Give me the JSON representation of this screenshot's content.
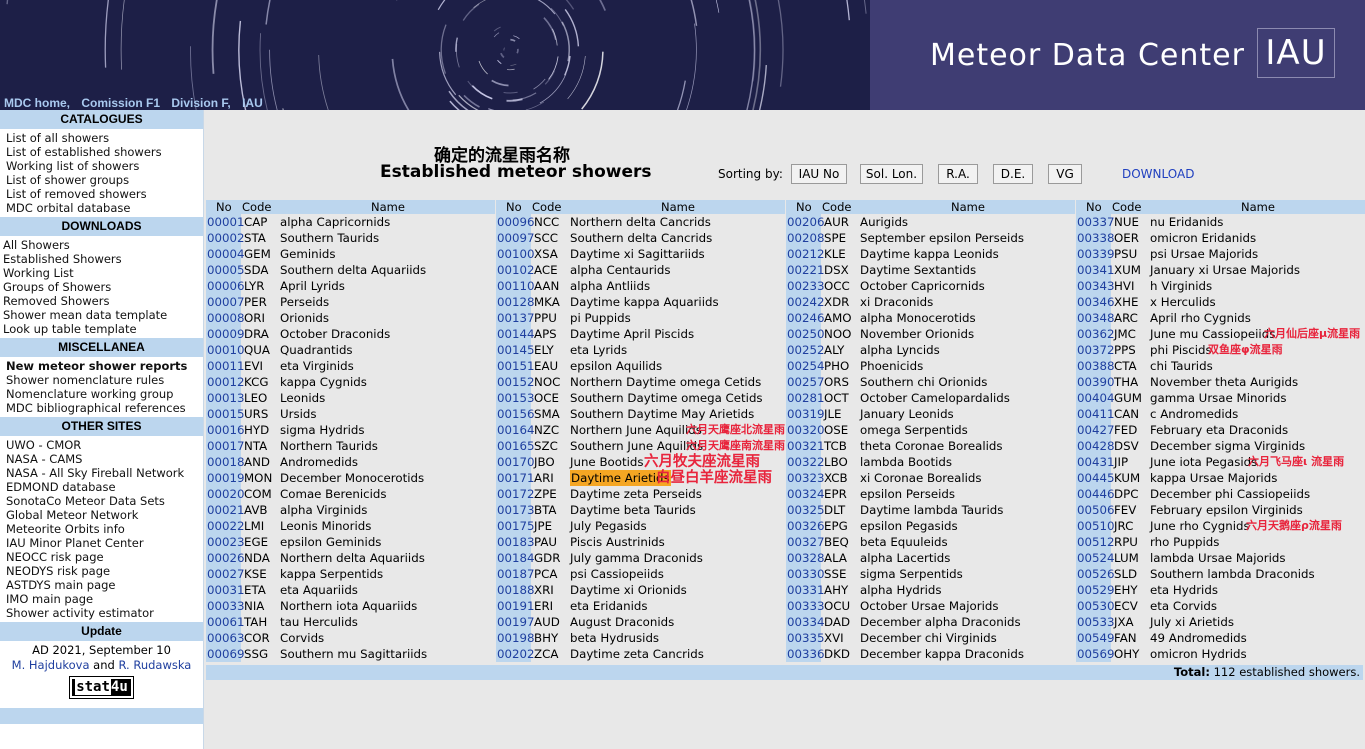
{
  "header": {
    "site_title": "Meteor Data Center",
    "logo_text": "IAU",
    "nav": [
      "MDC home,",
      "Comission F1",
      "Division F,",
      "IAU"
    ]
  },
  "sidebar": {
    "catalogues": {
      "title": "CATALOGUES",
      "items": [
        "List of all showers",
        "List of established showers",
        "Working list of showers",
        "List of shower groups",
        "List of removed showers",
        "MDC orbital database"
      ]
    },
    "downloads": {
      "title": "DOWNLOADS",
      "items": [
        "All Showers",
        "Established Showers",
        "Working List",
        "Groups of Showers",
        "Removed Showers",
        "Shower mean data template",
        "Look up table template"
      ]
    },
    "misc": {
      "title": "MISCELLANEA",
      "items": [
        "New meteor shower reports",
        "Shower nomenclature rules",
        "Nomenclature working group",
        "MDC bibliographical references"
      ]
    },
    "other": {
      "title": "OTHER SITES",
      "items": [
        "UWO - CMOR",
        "NASA - CAMS",
        "NASA - All Sky Fireball Network",
        "EDMOND database",
        "SonotaCo Meteor Data Sets",
        "Global Meteor Network",
        "Meteorite Orbits info",
        "IAU Minor Planet Center",
        "NEOCC risk page",
        "NEODYS risk page",
        "ASTDYS main page",
        "IMO main page",
        "Shower activity estimator"
      ]
    },
    "update": {
      "title": "Update",
      "date": "AD 2021, September 10",
      "author1": "M. Hajdukova",
      "and": "and",
      "author2": "R. Rudawska",
      "counter_a": "stat",
      "counter_b": "4u"
    }
  },
  "main": {
    "title_zh": "确定的流星雨名称",
    "title_en": "Established meteor showers",
    "sort_label": "Sorting by:",
    "sort_buttons": [
      "IAU No",
      "Sol. Lon.",
      "R.A.",
      "D.E.",
      "VG"
    ],
    "download": "DOWNLOAD",
    "col_headers": {
      "no": "No",
      "code": "Code",
      "name": "Name"
    },
    "total_label": "Total:",
    "total_value": "112 established showers."
  },
  "columns": [
    [
      [
        "00001",
        "CAP",
        "alpha Capricornids"
      ],
      [
        "00002",
        "STA",
        "Southern Taurids"
      ],
      [
        "00004",
        "GEM",
        "Geminids"
      ],
      [
        "00005",
        "SDA",
        "Southern delta Aquariids"
      ],
      [
        "00006",
        "LYR",
        "April Lyrids"
      ],
      [
        "00007",
        "PER",
        "Perseids"
      ],
      [
        "00008",
        "ORI",
        "Orionids"
      ],
      [
        "00009",
        "DRA",
        "October Draconids"
      ],
      [
        "00010",
        "QUA",
        "Quadrantids"
      ],
      [
        "00011",
        "EVI",
        "eta Virginids"
      ],
      [
        "00012",
        "KCG",
        "kappa Cygnids"
      ],
      [
        "00013",
        "LEO",
        "Leonids"
      ],
      [
        "00015",
        "URS",
        "Ursids"
      ],
      [
        "00016",
        "HYD",
        "sigma Hydrids"
      ],
      [
        "00017",
        "NTA",
        "Northern Taurids"
      ],
      [
        "00018",
        "AND",
        "Andromedids"
      ],
      [
        "00019",
        "MON",
        "December Monocerotids"
      ],
      [
        "00020",
        "COM",
        "Comae Berenicids"
      ],
      [
        "00021",
        "AVB",
        "alpha Virginids"
      ],
      [
        "00022",
        "LMI",
        "Leonis Minorids"
      ],
      [
        "00023",
        "EGE",
        "epsilon Geminids"
      ],
      [
        "00026",
        "NDA",
        "Northern delta Aquariids"
      ],
      [
        "00027",
        "KSE",
        "kappa Serpentids"
      ],
      [
        "00031",
        "ETA",
        "eta Aquariids"
      ],
      [
        "00033",
        "NIA",
        "Northern iota Aquariids"
      ],
      [
        "00061",
        "TAH",
        "tau Herculids"
      ],
      [
        "00063",
        "COR",
        "Corvids"
      ],
      [
        "00069",
        "SSG",
        "Southern mu Sagittariids"
      ]
    ],
    [
      [
        "00096",
        "NCC",
        "Northern delta Cancrids"
      ],
      [
        "00097",
        "SCC",
        "Southern delta Cancrids"
      ],
      [
        "00100",
        "XSA",
        "Daytime xi Sagittariids"
      ],
      [
        "00102",
        "ACE",
        "alpha Centaurids"
      ],
      [
        "00110",
        "AAN",
        "alpha Antliids"
      ],
      [
        "00128",
        "MKA",
        "Daytime kappa Aquariids"
      ],
      [
        "00137",
        "PPU",
        "pi Puppids"
      ],
      [
        "00144",
        "APS",
        "Daytime April Piscids"
      ],
      [
        "00145",
        "ELY",
        "eta Lyrids"
      ],
      [
        "00151",
        "EAU",
        "epsilon Aquilids"
      ],
      [
        "00152",
        "NOC",
        "Northern Daytime omega Cetids"
      ],
      [
        "00153",
        "OCE",
        "Southern Daytime omega Cetids"
      ],
      [
        "00156",
        "SMA",
        "Southern Daytime May Arietids"
      ],
      [
        "00164",
        "NZC",
        "Northern June Aquilids"
      ],
      [
        "00165",
        "SZC",
        "Southern June Aquilids"
      ],
      [
        "00170",
        "JBO",
        "June Bootids"
      ],
      [
        "00171",
        "ARI",
        "Daytime Arietids"
      ],
      [
        "00172",
        "ZPE",
        "Daytime zeta Perseids"
      ],
      [
        "00173",
        "BTA",
        "Daytime beta Taurids"
      ],
      [
        "00175",
        "JPE",
        "July Pegasids"
      ],
      [
        "00183",
        "PAU",
        "Piscis Austrinids"
      ],
      [
        "00184",
        "GDR",
        "July gamma Draconids"
      ],
      [
        "00187",
        "PCA",
        "psi Cassiopeiids"
      ],
      [
        "00188",
        "XRI",
        "Daytime xi Orionids"
      ],
      [
        "00191",
        "ERI",
        "eta Eridanids"
      ],
      [
        "00197",
        "AUD",
        "August Draconids"
      ],
      [
        "00198",
        "BHY",
        "beta Hydrusids"
      ],
      [
        "00202",
        "ZCA",
        "Daytime zeta Cancrids"
      ]
    ],
    [
      [
        "00206",
        "AUR",
        "Aurigids"
      ],
      [
        "00208",
        "SPE",
        "September epsilon Perseids"
      ],
      [
        "00212",
        "KLE",
        "Daytime kappa Leonids"
      ],
      [
        "00221",
        "DSX",
        "Daytime Sextantids"
      ],
      [
        "00233",
        "OCC",
        "October Capricornids"
      ],
      [
        "00242",
        "XDR",
        "xi Draconids"
      ],
      [
        "00246",
        "AMO",
        "alpha Monocerotids"
      ],
      [
        "00250",
        "NOO",
        "November Orionids"
      ],
      [
        "00252",
        "ALY",
        "alpha Lyncids"
      ],
      [
        "00254",
        "PHO",
        "Phoenicids"
      ],
      [
        "00257",
        "ORS",
        "Southern chi Orionids"
      ],
      [
        "00281",
        "OCT",
        "October Camelopardalids"
      ],
      [
        "00319",
        "JLE",
        "January Leonids"
      ],
      [
        "00320",
        "OSE",
        "omega Serpentids"
      ],
      [
        "00321",
        "TCB",
        "theta Coronae Borealids"
      ],
      [
        "00322",
        "LBO",
        "lambda Bootids"
      ],
      [
        "00323",
        "XCB",
        "xi Coronae Borealids"
      ],
      [
        "00324",
        "EPR",
        "epsilon Perseids"
      ],
      [
        "00325",
        "DLT",
        "Daytime lambda Taurids"
      ],
      [
        "00326",
        "EPG",
        "epsilon Pegasids"
      ],
      [
        "00327",
        "BEQ",
        "beta Equuleids"
      ],
      [
        "00328",
        "ALA",
        "alpha Lacertids"
      ],
      [
        "00330",
        "SSE",
        "sigma Serpentids"
      ],
      [
        "00331",
        "AHY",
        "alpha Hydrids"
      ],
      [
        "00333",
        "OCU",
        "October Ursae Majorids"
      ],
      [
        "00334",
        "DAD",
        "December alpha Draconids"
      ],
      [
        "00335",
        "XVI",
        "December chi Virginids"
      ],
      [
        "00336",
        "DKD",
        "December kappa Draconids"
      ]
    ],
    [
      [
        "00337",
        "NUE",
        "nu Eridanids"
      ],
      [
        "00338",
        "OER",
        "omicron Eridanids"
      ],
      [
        "00339",
        "PSU",
        "psi Ursae Majorids"
      ],
      [
        "00341",
        "XUM",
        "January xi Ursae Majorids"
      ],
      [
        "00343",
        "HVI",
        "h Virginids"
      ],
      [
        "00346",
        "XHE",
        "x Herculids"
      ],
      [
        "00348",
        "ARC",
        "April rho Cygnids"
      ],
      [
        "00362",
        "JMC",
        "June mu Cassiopeiids"
      ],
      [
        "00372",
        "PPS",
        "phi Piscids"
      ],
      [
        "00388",
        "CTA",
        "chi Taurids"
      ],
      [
        "00390",
        "THA",
        "November theta Aurigids"
      ],
      [
        "00404",
        "GUM",
        "gamma Ursae Minorids"
      ],
      [
        "00411",
        "CAN",
        "c Andromedids"
      ],
      [
        "00427",
        "FED",
        "February eta Draconids"
      ],
      [
        "00428",
        "DSV",
        "December sigma Virginids"
      ],
      [
        "00431",
        "JIP",
        "June iota Pegasids"
      ],
      [
        "00445",
        "KUM",
        "kappa Ursae Majorids"
      ],
      [
        "00446",
        "DPC",
        "December phi Cassiopeiids"
      ],
      [
        "00506",
        "FEV",
        "February epsilon Virginids"
      ],
      [
        "00510",
        "JRC",
        "June rho Cygnids"
      ],
      [
        "00512",
        "RPU",
        "rho Puppids"
      ],
      [
        "00524",
        "LUM",
        "lambda Ursae Majorids"
      ],
      [
        "00526",
        "SLD",
        "Southern lambda Draconids"
      ],
      [
        "00529",
        "EHY",
        "eta Hydrids"
      ],
      [
        "00530",
        "ECV",
        "eta Corvids"
      ],
      [
        "00533",
        "JXA",
        "July xi Arietids"
      ],
      [
        "00549",
        "FAN",
        "49 Andromedids"
      ],
      [
        "00569",
        "OHY",
        "omicron Hydrids"
      ]
    ]
  ],
  "annotations_zh": {
    "nzc": "六月天鹰座北流星雨",
    "szc": "六月天鹰座南流星雨",
    "jbo": "六月牧夫座流星雨",
    "ari": "白昼白羊座流星雨",
    "jmc": "六月仙后座μ流星雨",
    "pps": "双鱼座φ流星雨",
    "jip": "六月飞马座ι 流星雨",
    "jrc": "六月天鹅座ρ流星雨"
  },
  "colors": {
    "header_bg": "#3f3d73",
    "sidebar_head": "#bcd6ee",
    "main_bg": "#e8e8e8",
    "highlight": "#f5a623",
    "annotation": "#e8243c",
    "link": "#1f3fbf"
  }
}
